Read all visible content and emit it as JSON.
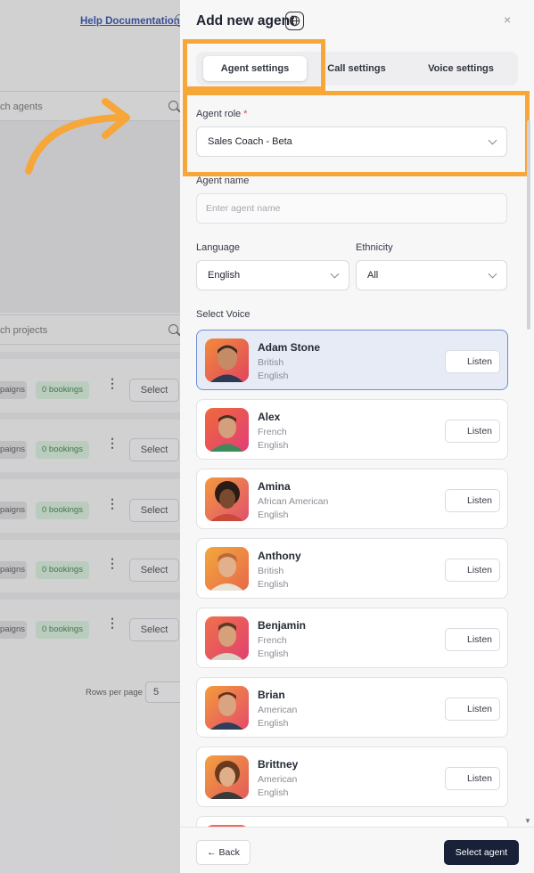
{
  "background": {
    "help_link": "Help Documentation",
    "search_agents_placeholder": "ch agents",
    "search_projects_placeholder": "ch projects",
    "rows": [
      {
        "campaigns": "paigns",
        "bookings": "0 bookings",
        "select": "Select"
      },
      {
        "campaigns": "paigns",
        "bookings": "0 bookings",
        "select": "Select"
      },
      {
        "campaigns": "paigns",
        "bookings": "0 bookings",
        "select": "Select"
      },
      {
        "campaigns": "paigns",
        "bookings": "0 bookings",
        "select": "Select"
      },
      {
        "campaigns": "paigns",
        "bookings": "0 bookings",
        "select": "Select"
      }
    ],
    "rows_per_page_label": "Rows per page",
    "rows_per_page_value": "5"
  },
  "drawer": {
    "title": "Add new agent",
    "close": "×",
    "tabs": [
      "Agent settings",
      "Call settings",
      "Voice settings"
    ],
    "active_tab": "Agent settings",
    "agent_role": {
      "label": "Agent role",
      "required_mark": "*",
      "value": "Sales Coach - Beta"
    },
    "agent_name": {
      "label": "Agent name",
      "placeholder": "Enter agent name"
    },
    "language": {
      "label": "Language",
      "value": "English"
    },
    "ethnicity": {
      "label": "Ethnicity",
      "value": "All"
    },
    "voice_label": "Select Voice",
    "listen_label": "Listen",
    "voices": [
      {
        "name": "Adam Stone",
        "accent": "British",
        "language": "English",
        "selected": true
      },
      {
        "name": "Alex",
        "accent": "French",
        "language": "English",
        "selected": false
      },
      {
        "name": "Amina",
        "accent": "African American",
        "language": "English",
        "selected": false
      },
      {
        "name": "Anthony",
        "accent": "British",
        "language": "English",
        "selected": false
      },
      {
        "name": "Benjamin",
        "accent": "French",
        "language": "English",
        "selected": false
      },
      {
        "name": "Brian",
        "accent": "American",
        "language": "English",
        "selected": false
      },
      {
        "name": "Brittney",
        "accent": "American",
        "language": "English",
        "selected": false
      }
    ],
    "back_button": "← Back",
    "select_agent_button": "Select agent"
  },
  "colors": {
    "highlight": "#f7a63a",
    "primary_button": "#192138",
    "selected_card_border": "#6d8fd8",
    "booking_badge": "#cde3d0"
  }
}
